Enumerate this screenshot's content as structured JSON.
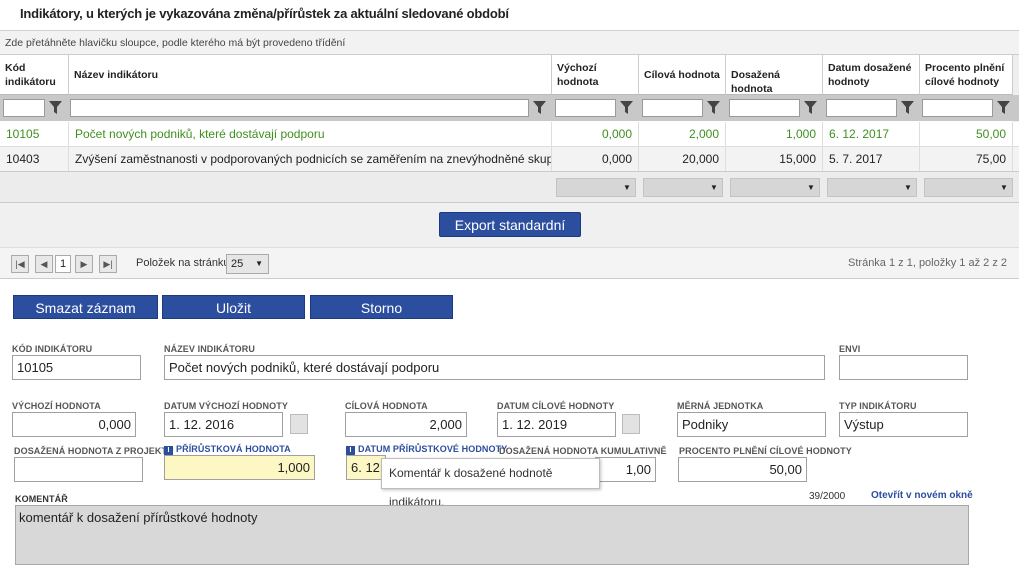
{
  "grid": {
    "title": "Indikátory, u kterých je vykazována změna/přírůstek za aktuální sledované období",
    "group_hint": "Zde přetáhněte hlavičku sloupce, podle kterého má být provedeno třídění",
    "columns": [
      "Kód indikátoru",
      "Název indikátoru",
      "Výchozí hodnota",
      "Cílová hodnota",
      "Dosažená hodnota",
      "Datum dosažené hodnoty",
      "Procento plnění cílové hodnoty"
    ],
    "rows": [
      [
        "10105",
        "Počet nových podniků, které dostávají podporu",
        "0,000",
        "2,000",
        "1,000",
        "6. 12. 2017",
        "50,00"
      ],
      [
        "10403",
        "Zvýšení zaměstnanosti v podporovaných podnicích se zaměřením na znevýhodněné skup...",
        "0,000",
        "20,000",
        "15,000",
        "5. 7. 2017",
        "75,00"
      ]
    ],
    "export_label": "Export standardní",
    "pager": {
      "page": "1",
      "per_page_label": "Položek na stránku",
      "per_page_value": "25",
      "summary": "Stránka 1 z 1, položky 1 až 2 z 2"
    }
  },
  "actions": {
    "delete": "Smazat záznam",
    "save": "Uložit",
    "cancel": "Storno"
  },
  "form": {
    "kod_label": "Kód indikátoru",
    "kod_value": "10105",
    "nazev_label": "Název indikátoru",
    "nazev_value": "Počet nových podniků, které dostávají podporu",
    "envi_label": "ENVI",
    "envi_value": "",
    "vychozi_label": "Výchozí hodnota",
    "vychozi_value": "0,000",
    "datum_vychozi_label": "Datum výchozí hodnoty",
    "datum_vychozi_value": "1. 12. 2016",
    "cilova_label": "Cílová hodnota",
    "cilova_value": "2,000",
    "datum_cilove_label": "Datum cílové hodnoty",
    "datum_cilove_value": "1. 12. 2019",
    "jednotka_label": "Měrná jednotka",
    "jednotka_value": "Podniky",
    "typ_label": "Typ indikátoru",
    "typ_value": "Výstup",
    "dosazena_proj_label": "Dosažená hodnota z projektu",
    "dosazena_proj_value": "",
    "prirustkova_label": "Přírůstková hodnota",
    "prirustkova_value": "1,000",
    "datum_prir_label": "Datum přírůstkové hodnoty",
    "datum_prir_value": "6. 12.",
    "kumulativ_label": "Dosažená hodnota kumulativně",
    "kumulativ_value": "1,00",
    "procento_label": "Procento plnění cílové hodnoty",
    "procento_value": "50,00",
    "komentar_label": "Komentář",
    "komentar_count": "39/2000",
    "open_new_window": "Otevřít v novém okně",
    "komentar_value": "komentář k dosažení přírůstkové hodnoty",
    "tooltip": "Komentář k dosažené hodnotě indikátoru."
  },
  "colors": {
    "accent": "#2c4e9e",
    "highlight_row_text": "#3f8f1f",
    "required_field": "#fdf7c4"
  }
}
